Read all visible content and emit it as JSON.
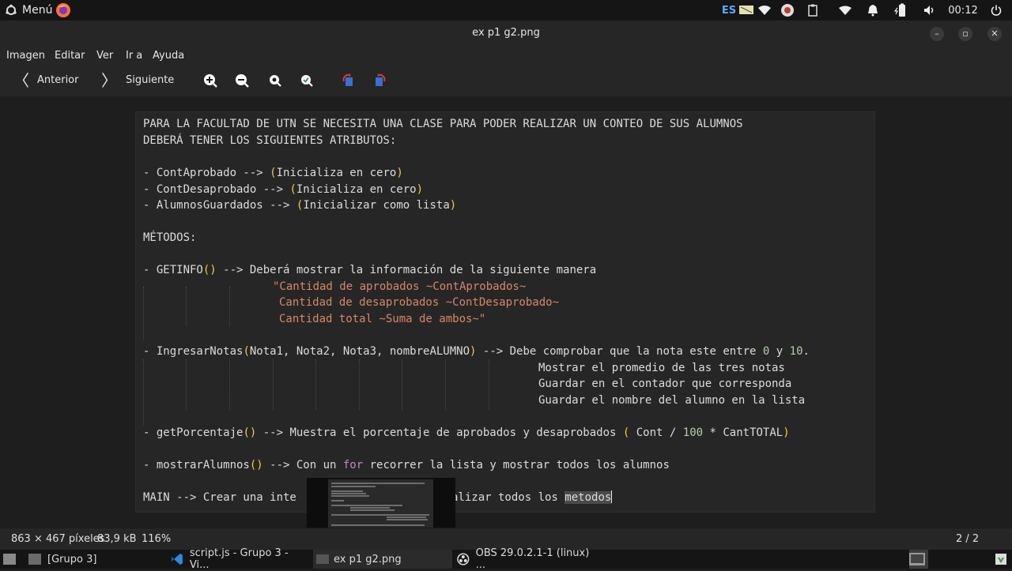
{
  "top_panel": {
    "menu_label": "Menú",
    "keyboard_layout": "ES",
    "clock": "00:12"
  },
  "window": {
    "title": "ex p1 g2.png"
  },
  "menu_bar": {
    "items": [
      "Imagen",
      "Editar",
      "Ver",
      "Ir a",
      "Ayuda"
    ]
  },
  "toolbar": {
    "prev_label": "Anterior",
    "next_label": "Siguiente"
  },
  "document": {
    "lines": {
      "l1": "PARA LA FACULTAD DE UTN SE NECESITA UNA CLASE PARA PODER REALIZAR UN CONTEO DE SUS ALUMNOS",
      "l2": "DEBERÁ TENER LOS SIGUIENTES ATRIBUTOS:",
      "l3a": "- ContAprobado --> ",
      "l3b": "(",
      "l3c": "Inicializa en cero",
      "l3d": ")",
      "l4a": "- ContDesaprobado --> ",
      "l4b": "(",
      "l4c": "Inicializa en cero",
      "l4d": ")",
      "l5a": "- AlumnosGuardados --> ",
      "l5b": "(",
      "l5c": "Inicializar como lista",
      "l5d": ")",
      "l6": "MÉTODOS:",
      "l7a": "- GETINFO",
      "l7b": "()",
      "l7c": " --> Deberá mostrar la información de la siguiente manera",
      "l8": "\"Cantidad de aprobados ~ContAprobados~",
      "l9": "Cantidad de desaprobados ~ContDesaprobado~",
      "l10": "Cantidad total ~Suma de ambos~\"",
      "l11a": "- IngresarNotas",
      "l11b": "(",
      "l11c": "Nota1, Nota2, Nota3, nombreALUMNO",
      "l11d": ")",
      "l11e": " --> Debe comprobar que la nota este entre ",
      "l11f": "0",
      "l11g": " y ",
      "l11h": "10",
      "l11i": ".",
      "l12": "Mostrar el promedio de las tres notas",
      "l13": "Guardar en el contador que corresponda",
      "l14": "Guardar el nombre del alumno en la lista",
      "l15a": "- getPorcentaje",
      "l15b": "()",
      "l15c": " --> Muestra el porcentaje de aprobados y desaprobados ",
      "l15d": "(",
      "l15e": " Cont / ",
      "l15f": "100",
      "l15g": " * CantTOTAL",
      "l15h": ")",
      "l16a": "- mostrarAlumnos",
      "l16b": "()",
      "l16c": " --> Con un ",
      "l16d": "for",
      "l16e": " recorrer la lista y mostrar todos los alumnos",
      "l17a": "MAIN --> Crear una inte",
      "l17b": "alizar todos los ",
      "l17c": "metodos"
    }
  },
  "status_bar": {
    "dimensions": "863 × 467 píxeles",
    "file_size": "83,9 kB",
    "zoom": "116%",
    "page": "2 / 2"
  },
  "taskbar": {
    "items": [
      "[Grupo 3]",
      "script.js - Grupo 3 - Vi...",
      "ex p1 g2.png",
      "OBS 29.0.2.1-1 (linux) ..."
    ]
  },
  "colors": {
    "accent_zoom": "#7ec8e3",
    "paren": "#f2c94c",
    "string": "#d8876a",
    "number": "#b5cea8",
    "keyword": "#c586c0"
  }
}
